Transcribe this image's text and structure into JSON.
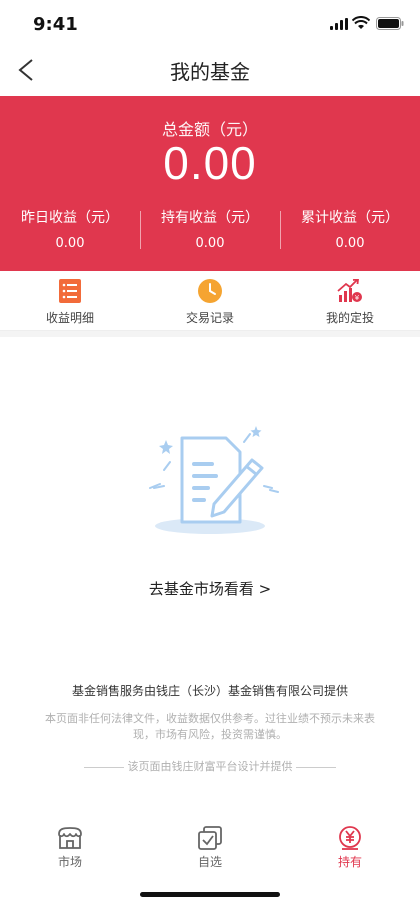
{
  "status_bar": {
    "time": "9:41"
  },
  "nav": {
    "title": "我的基金"
  },
  "summary": {
    "total_label": "总金额（元）",
    "total_value": "0.00",
    "stats": [
      {
        "label": "昨日收益（元）",
        "value": "0.00"
      },
      {
        "label": "持有收益（元）",
        "value": "0.00"
      },
      {
        "label": "累计收益（元）",
        "value": "0.00"
      }
    ]
  },
  "quick_links": [
    {
      "label": "收益明细",
      "icon": "list-icon"
    },
    {
      "label": "交易记录",
      "icon": "clock-icon"
    },
    {
      "label": "我的定投",
      "icon": "chart-icon"
    }
  ],
  "empty_state": {
    "link_text": "去基金市场看看 >"
  },
  "footer": {
    "provider": "基金销售服务由钱庄（长沙）基金销售有限公司提供",
    "disclaimer": "本页面非任何法律文件，收益数据仅供参考。过往业绩不预示未来表现，市场有风险，投资需谨慎。",
    "platform": "该页面由钱庄财富平台设计并提供"
  },
  "tabs": [
    {
      "label": "市场",
      "icon": "shop-icon",
      "active": false
    },
    {
      "label": "自选",
      "icon": "checkbox-icon",
      "active": false
    },
    {
      "label": "持有",
      "icon": "yuan-icon",
      "active": true
    }
  ],
  "colors": {
    "accent": "#e0374e",
    "orange": "#f26b3a",
    "clock": "#f5a431",
    "illustration": "#a9cdf0"
  }
}
